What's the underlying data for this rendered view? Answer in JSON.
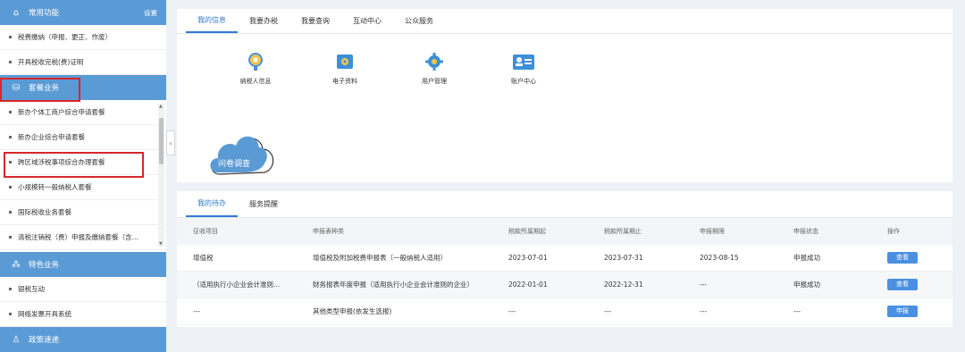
{
  "sidebar": {
    "common": {
      "title": "常用功能",
      "settings": "设置",
      "items": [
        "税费缴纳（申报、更正、作废）",
        "开具税收完税(费)证明"
      ]
    },
    "package": {
      "title": "套餐业务",
      "items": [
        "新办个体工商户综合申请套餐",
        "新办企业综合申请套餐",
        "跨区域涉税事项综合办理套餐",
        "小规模转一般纳税人套餐",
        "国际税收业务套餐",
        "清税注销税（费）申报及缴纳套餐（含…"
      ]
    },
    "special": {
      "title": "特色业务",
      "items": [
        "银税互动",
        "网络发票开具系统"
      ]
    },
    "policy": {
      "title": "政策速递"
    }
  },
  "top_tabs": [
    "我的信息",
    "我要办税",
    "我要查询",
    "互动中心",
    "公众服务"
  ],
  "quick_icons": [
    {
      "label": "纳税人信息",
      "icon": "taxpayer-info-icon"
    },
    {
      "label": "电子资料",
      "icon": "e-document-icon"
    },
    {
      "label": "用户管理",
      "icon": "user-management-icon"
    },
    {
      "label": "账户中心",
      "icon": "account-center-icon"
    }
  ],
  "survey": {
    "label": "问卷调查"
  },
  "bottom_tabs": [
    "我的待办",
    "服务提醒"
  ],
  "table": {
    "headers": [
      "征收项目",
      "申报表种类",
      "税款所属期起",
      "税款所属期止",
      "申报期限",
      "申报状态",
      "操作"
    ],
    "rows": [
      [
        "增值税",
        "增值税及附加税费申报表（一般纳税人适用）",
        "2023-07-01",
        "2023-07-31",
        "2023-08-15",
        "申报成功",
        "查看"
      ],
      [
        "（适用执行小企业会计准则...",
        "财务报表年度申报（适用执行小企业会计准则的企业）",
        "2022-01-01",
        "2022-12-31",
        "---",
        "申报成功",
        "查看"
      ],
      [
        "---",
        "其他类型申报(依发生选报)",
        "---",
        "---",
        "---",
        "---",
        "申报"
      ]
    ]
  },
  "colors": {
    "accent": "#5b9bd5",
    "highlight": "#d9262c",
    "button": "#4a90e2",
    "tab_active": "#2d7bd6"
  }
}
